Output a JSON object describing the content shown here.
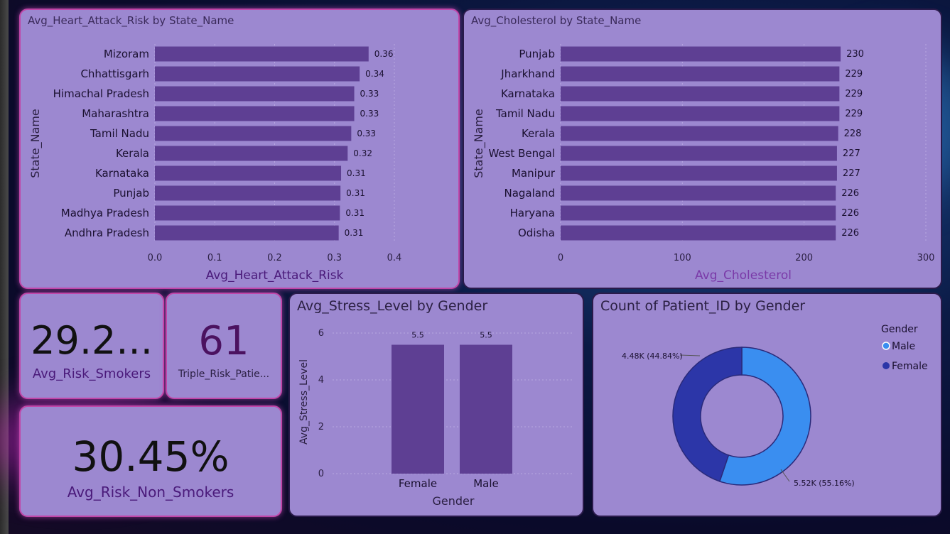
{
  "heart_chart": {
    "title": "Avg_Heart_Attack_Risk by State_Name",
    "xlabel": "Avg_Heart_Attack_Risk",
    "ylabel": "State_Name",
    "ticks": [
      "0.0",
      "0.1",
      "0.2",
      "0.3",
      "0.4"
    ]
  },
  "chol_chart": {
    "title": "Avg_Cholesterol by State_Name",
    "xlabel": "Avg_Cholesterol",
    "ylabel": "State_Name",
    "ticks": [
      "0",
      "100",
      "200",
      "300"
    ]
  },
  "stress_chart": {
    "title": "Avg_Stress_Level by Gender",
    "xlabel": "Gender",
    "ylabel": "Avg_Stress_Level",
    "ticks": [
      "0",
      "2",
      "4",
      "6"
    ]
  },
  "donut_chart": {
    "title": "Count of Patient_ID by Gender",
    "legend_title": "Gender",
    "male_label": "5.52K (55.16%)",
    "female_label": "4.48K (44.84%)"
  },
  "kpis": {
    "smokers_value": "29.2...",
    "smokers_label": "Avg_Risk_Smokers",
    "triple_value": "61",
    "triple_label": "Triple_Risk_Patie...",
    "nonsmokers_value": "30.45%",
    "nonsmokers_label": "Avg_Risk_Non_Smokers"
  },
  "colors": {
    "bar": "#5e3f93",
    "panel": "#9c88d0",
    "male": "#3a8ef0",
    "female": "#2c36a8"
  },
  "chart_data": [
    {
      "type": "bar",
      "orientation": "horizontal",
      "title": "Avg_Heart_Attack_Risk by State_Name",
      "xlabel": "Avg_Heart_Attack_Risk",
      "ylabel": "State_Name",
      "xlim": [
        0,
        0.4
      ],
      "categories": [
        "Mizoram",
        "Chhattisgarh",
        "Himachal Pradesh",
        "Maharashtra",
        "Tamil Nadu",
        "Kerala",
        "Karnataka",
        "Punjab",
        "Madhya Pradesh",
        "Andhra Pradesh"
      ],
      "values": [
        0.357,
        0.342,
        0.333,
        0.333,
        0.328,
        0.322,
        0.311,
        0.31,
        0.309,
        0.307
      ],
      "data_labels": [
        "0.36",
        "0.34",
        "0.33",
        "0.33",
        "0.33",
        "0.32",
        "0.31",
        "0.31",
        "0.31",
        "0.31"
      ]
    },
    {
      "type": "bar",
      "orientation": "horizontal",
      "title": "Avg_Cholesterol by State_Name",
      "xlabel": "Avg_Cholesterol",
      "ylabel": "State_Name",
      "xlim": [
        0,
        300
      ],
      "categories": [
        "Punjab",
        "Jharkhand",
        "Karnataka",
        "Tamil Nadu",
        "Kerala",
        "West Bengal",
        "Manipur",
        "Nagaland",
        "Haryana",
        "Odisha"
      ],
      "values": [
        230,
        229,
        229,
        229,
        228,
        227,
        227,
        226,
        226,
        226
      ],
      "data_labels": [
        "230",
        "229",
        "229",
        "229",
        "228",
        "227",
        "227",
        "226",
        "226",
        "226"
      ]
    },
    {
      "type": "bar",
      "title": "Avg_Stress_Level by Gender",
      "xlabel": "Gender",
      "ylabel": "Avg_Stress_Level",
      "ylim": [
        0,
        6
      ],
      "categories": [
        "Female",
        "Male"
      ],
      "values": [
        5.5,
        5.5
      ],
      "data_labels": [
        "5.5",
        "5.5"
      ]
    },
    {
      "type": "pie",
      "title": "Count of Patient_ID by Gender",
      "categories": [
        "Male",
        "Female"
      ],
      "values": [
        5520,
        4480
      ],
      "percentages": [
        55.16,
        44.84
      ],
      "legend_position": "top-right"
    }
  ]
}
